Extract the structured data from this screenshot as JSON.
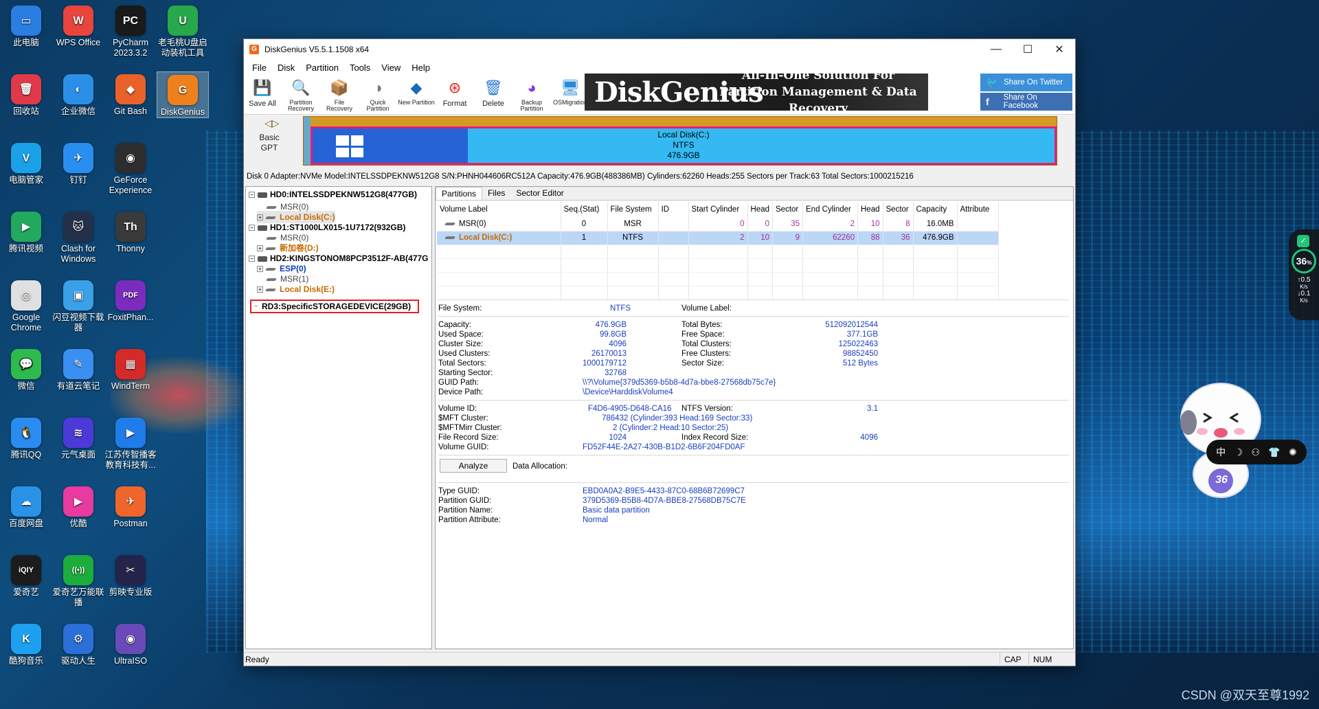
{
  "desktop_icons": [
    {
      "label": "此电脑",
      "color": "#2a7de1",
      "glyph": "▭"
    },
    {
      "label": "WPS Office",
      "color": "#e8453c",
      "glyph": "W"
    },
    {
      "label": "PyCharm 2023.3.2",
      "color": "#1a1a1a",
      "glyph": "PC"
    },
    {
      "label": "老毛桃U盘启动装机工具",
      "color": "#27a84a",
      "glyph": "U"
    },
    {
      "label": "回收站",
      "color": "#e03a4a",
      "glyph": "🗑"
    },
    {
      "label": "企业微信",
      "color": "#2b8fe8",
      "glyph": "◐"
    },
    {
      "label": "Git Bash",
      "color": "#e8622a",
      "glyph": "◆"
    },
    {
      "label": "DiskGenius",
      "color": "#f0801e",
      "glyph": "G"
    },
    {
      "label": "电脑管家",
      "color": "#1aa1e8",
      "glyph": "V"
    },
    {
      "label": "钉钉",
      "color": "#2a8ef0",
      "glyph": "✈"
    },
    {
      "label": "GeForce Experience",
      "color": "#2d2d2d",
      "glyph": "◉"
    },
    {
      "label": "腾讯视频",
      "color": "#21a95e",
      "glyph": "▶"
    },
    {
      "label": "Clash for Windows",
      "color": "#24304a",
      "glyph": "🐱"
    },
    {
      "label": "Thonny",
      "color": "#3a3a3a",
      "glyph": "Th"
    },
    {
      "label": "Google Chrome",
      "color": "#e0e0e0",
      "glyph": "◎"
    },
    {
      "label": "闪豆视频下载器",
      "color": "#3aa0e8",
      "glyph": "▣"
    },
    {
      "label": "FoxitPhan...",
      "color": "#7b2cbf",
      "glyph": "PDF"
    },
    {
      "label": "微信",
      "color": "#2dbb4e",
      "glyph": "💬"
    },
    {
      "label": "有道云笔记",
      "color": "#3b8ff0",
      "glyph": "✎"
    },
    {
      "label": "WindTerm",
      "color": "#d42a2a",
      "glyph": "▦"
    },
    {
      "label": "腾讯QQ",
      "color": "#2a8cf0",
      "glyph": "🐧"
    },
    {
      "label": "元气桌面",
      "color": "#4b3ad8",
      "glyph": "≋"
    },
    {
      "label": "江苏传智播客教育科技有...",
      "color": "#1f7ce8",
      "glyph": "▶"
    },
    {
      "label": "百度网盘",
      "color": "#2a93e8",
      "glyph": "☁"
    },
    {
      "label": "优酷",
      "color": "#e83aa0",
      "glyph": "▶"
    },
    {
      "label": "Postman",
      "color": "#f0652b",
      "glyph": "✈"
    },
    {
      "label": "爱奇艺",
      "color": "#1c1c1c",
      "glyph": "iQIY"
    },
    {
      "label": "爱奇艺万能联播",
      "color": "#1cae3c",
      "glyph": "((•))"
    },
    {
      "label": "剪映专业版",
      "color": "#24244a",
      "glyph": "✂"
    },
    {
      "label": "酷狗音乐",
      "color": "#1ea0f0",
      "glyph": "K"
    },
    {
      "label": "驱动人生",
      "color": "#2b6fd8",
      "glyph": "⚙"
    },
    {
      "label": "UltraISO",
      "color": "#6a4ab8",
      "glyph": "◉"
    }
  ],
  "window": {
    "title": "DiskGenius V5.5.1.1508 x64",
    "menu": [
      "File",
      "Disk",
      "Partition",
      "Tools",
      "View",
      "Help"
    ],
    "toolbar": [
      {
        "label": "Save All",
        "icon": "save-icon"
      },
      {
        "label": "Partition Recovery",
        "icon": "partition-recovery-icon"
      },
      {
        "label": "File Recovery",
        "icon": "file-recovery-icon"
      },
      {
        "label": "Quick Partition",
        "icon": "quick-partition-icon"
      },
      {
        "label": "New Partition",
        "icon": "new-partition-icon"
      },
      {
        "label": "Format",
        "icon": "format-icon"
      },
      {
        "label": "Delete",
        "icon": "delete-icon"
      },
      {
        "label": "Backup Partition",
        "icon": "backup-partition-icon"
      },
      {
        "label": "OSMigration",
        "icon": "os-migration-icon"
      }
    ],
    "banner": {
      "brand": "DiskGenius",
      "slogan1": "All-In-One Solution For",
      "slogan2": "Partition Management & Data Recovery"
    },
    "share": {
      "twitter": "Share On Twitter",
      "facebook": "Share On Facebook"
    }
  },
  "diskmap": {
    "type_line1": "Basic",
    "type_line2": "GPT",
    "partition_name": "Local Disk(C:)",
    "fs": "NTFS",
    "size": "476.9GB",
    "used_fraction": 0.209
  },
  "disk_info": "Disk 0 Adapter:NVMe  Model:INTELSSDPEKNW512G8  S/N:PHNH044606RC512A  Capacity:476.9GB(488386MB)  Cylinders:62260  Heads:255  Sectors per Track:63  Total Sectors:1000215216",
  "tree": {
    "hd0": "HD0:INTELSSDPEKNW512G8(477GB)",
    "hd0_msr": "MSR(0)",
    "hd0_c": "Local Disk(C:)",
    "hd1": "HD1:ST1000LX015-1U7172(932GB)",
    "hd1_msr": "MSR(0)",
    "hd1_d": "新加卷(D:)",
    "hd2": "HD2:KINGSTONOM8PCP3512F-AB(477G",
    "hd2_esp": "ESP(0)",
    "hd2_msr": "MSR(1)",
    "hd2_e": "Local Disk(E:)",
    "rd3": "RD3:SpecificSTORAGEDEVICE(29GB)"
  },
  "tabs": [
    "Partitions",
    "Files",
    "Sector Editor"
  ],
  "partition_table": {
    "headers": [
      "Volume Label",
      "Seq.(Stat)",
      "File System",
      "ID",
      "Start Cylinder",
      "Head",
      "Sector",
      "End Cylinder",
      "Head",
      "Sector",
      "Capacity",
      "Attribute"
    ],
    "rows": [
      [
        "MSR(0)",
        "0",
        "MSR",
        "",
        "0",
        "0",
        "35",
        "2",
        "10",
        "8",
        "16.0MB",
        ""
      ],
      [
        "Local Disk(C:)",
        "1",
        "NTFS",
        "",
        "2",
        "10",
        "9",
        "62260",
        "88",
        "36",
        "476.9GB",
        ""
      ]
    ]
  },
  "details": {
    "fs_label": "File System:",
    "fs_val": "NTFS",
    "vol_label": "Volume Label:",
    "capacity_label": "Capacity:",
    "capacity_val": "476.9GB",
    "used_label": "Used Space:",
    "used_val": "99.8GB",
    "cluster_label": "Cluster Size:",
    "cluster_val": "4096",
    "used_clusters_label": "Used Clusters:",
    "used_clusters_val": "26170013",
    "total_sectors_label": "Total Sectors:",
    "total_sectors_val": "1000179712",
    "start_sector_label": "Starting Sector:",
    "start_sector_val": "32768",
    "guid_path_label": "GUID Path:",
    "guid_path_val": "\\\\?\\Volume{379d5369-b5b8-4d7a-bbe8-27568db75c7e}",
    "device_path_label": "Device Path:",
    "device_path_val": "\\Device\\HarddiskVolume4",
    "total_bytes_label": "Total Bytes:",
    "total_bytes_val": "512092012544",
    "free_space_label": "Free Space:",
    "free_space_val": "377.1GB",
    "total_clusters_label": "Total Clusters:",
    "total_clusters_val": "125022463",
    "free_clusters_label": "Free Clusters:",
    "free_clusters_val": "98852450",
    "sector_size_label": "Sector Size:",
    "sector_size_val": "512 Bytes",
    "volume_id_label": "Volume ID:",
    "volume_id_val": "F4D6-4905-D648-CA16",
    "ntfs_version_label": "NTFS Version:",
    "ntfs_version_val": "3.1",
    "mft_label": "$MFT Cluster:",
    "mft_val": "786432 (Cylinder:393 Head:169 Sector:33)",
    "mftmirr_label": "$MFTMirr Cluster:",
    "mftmirr_val": "2 (Cylinder:2 Head:10 Sector:25)",
    "frs_label": "File Record Size:",
    "frs_val": "1024",
    "irs_label": "Index Record Size:",
    "irs_val": "4096",
    "vguid_label": "Volume GUID:",
    "vguid_val": "FD52F44E-2A27-430B-B1D2-6B6F204FD0AF",
    "analyze": "Analyze",
    "data_alloc_label": "Data Allocation:",
    "type_guid_label": "Type GUID:",
    "type_guid_val": "EBD0A0A2-B9E5-4433-87C0-68B6B72699C7",
    "part_guid_label": "Partition GUID:",
    "part_guid_val": "379D5369-B5B8-4D7A-BBE8-27568DB75C7E",
    "part_name_label": "Partition Name:",
    "part_name_val": "Basic data partition",
    "part_attr_label": "Partition Attribute:",
    "part_attr_val": "Normal"
  },
  "status": {
    "text": "Ready",
    "cap": "CAP",
    "num": "NUM"
  },
  "widgets": {
    "percent": "36",
    "percent_unit": "%",
    "up": "0.5",
    "down": "0.1",
    "rate_unit": "K/s",
    "ime": "中",
    "mascot_number": "36",
    "watermark": "CSDN @双天至尊1992"
  }
}
